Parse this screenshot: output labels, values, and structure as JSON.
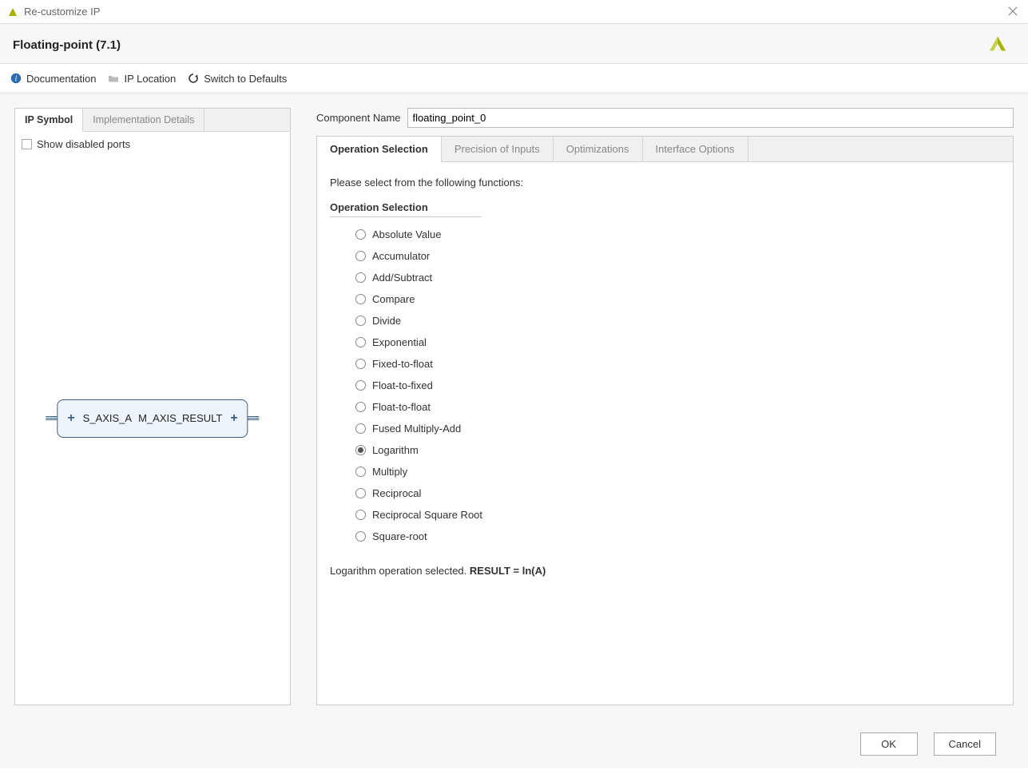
{
  "window_title": "Re-customize IP",
  "header_title": "Floating-point (7.1)",
  "toolbar": {
    "documentation": "Documentation",
    "ip_location": "IP Location",
    "switch_defaults": "Switch to Defaults"
  },
  "left": {
    "tabs": {
      "ip_symbol": "IP Symbol",
      "impl_details": "Implementation Details"
    },
    "show_disabled": "Show disabled ports",
    "port_in": "S_AXIS_A",
    "port_out": "M_AXIS_RESULT"
  },
  "component_name_label": "Component Name",
  "component_name_value": "floating_point_0",
  "config_tabs": {
    "operation_selection": "Operation Selection",
    "precision": "Precision of Inputs",
    "optimizations": "Optimizations",
    "interface": "Interface Options"
  },
  "instruction": "Please select from the following functions:",
  "fieldset_label": "Operation Selection",
  "operations": [
    {
      "label": "Absolute Value",
      "selected": false
    },
    {
      "label": "Accumulator",
      "selected": false
    },
    {
      "label": "Add/Subtract",
      "selected": false
    },
    {
      "label": "Compare",
      "selected": false
    },
    {
      "label": "Divide",
      "selected": false
    },
    {
      "label": "Exponential",
      "selected": false
    },
    {
      "label": "Fixed-to-float",
      "selected": false
    },
    {
      "label": "Float-to-fixed",
      "selected": false
    },
    {
      "label": "Float-to-float",
      "selected": false
    },
    {
      "label": "Fused Multiply-Add",
      "selected": false
    },
    {
      "label": "Logarithm",
      "selected": true
    },
    {
      "label": "Multiply",
      "selected": false
    },
    {
      "label": "Reciprocal",
      "selected": false
    },
    {
      "label": "Reciprocal Square Root",
      "selected": false
    },
    {
      "label": "Square-root",
      "selected": false
    }
  ],
  "result_prefix": "Logarithm operation selected. ",
  "result_formula": "RESULT = ln(A)",
  "footer": {
    "ok": "OK",
    "cancel": "Cancel"
  }
}
